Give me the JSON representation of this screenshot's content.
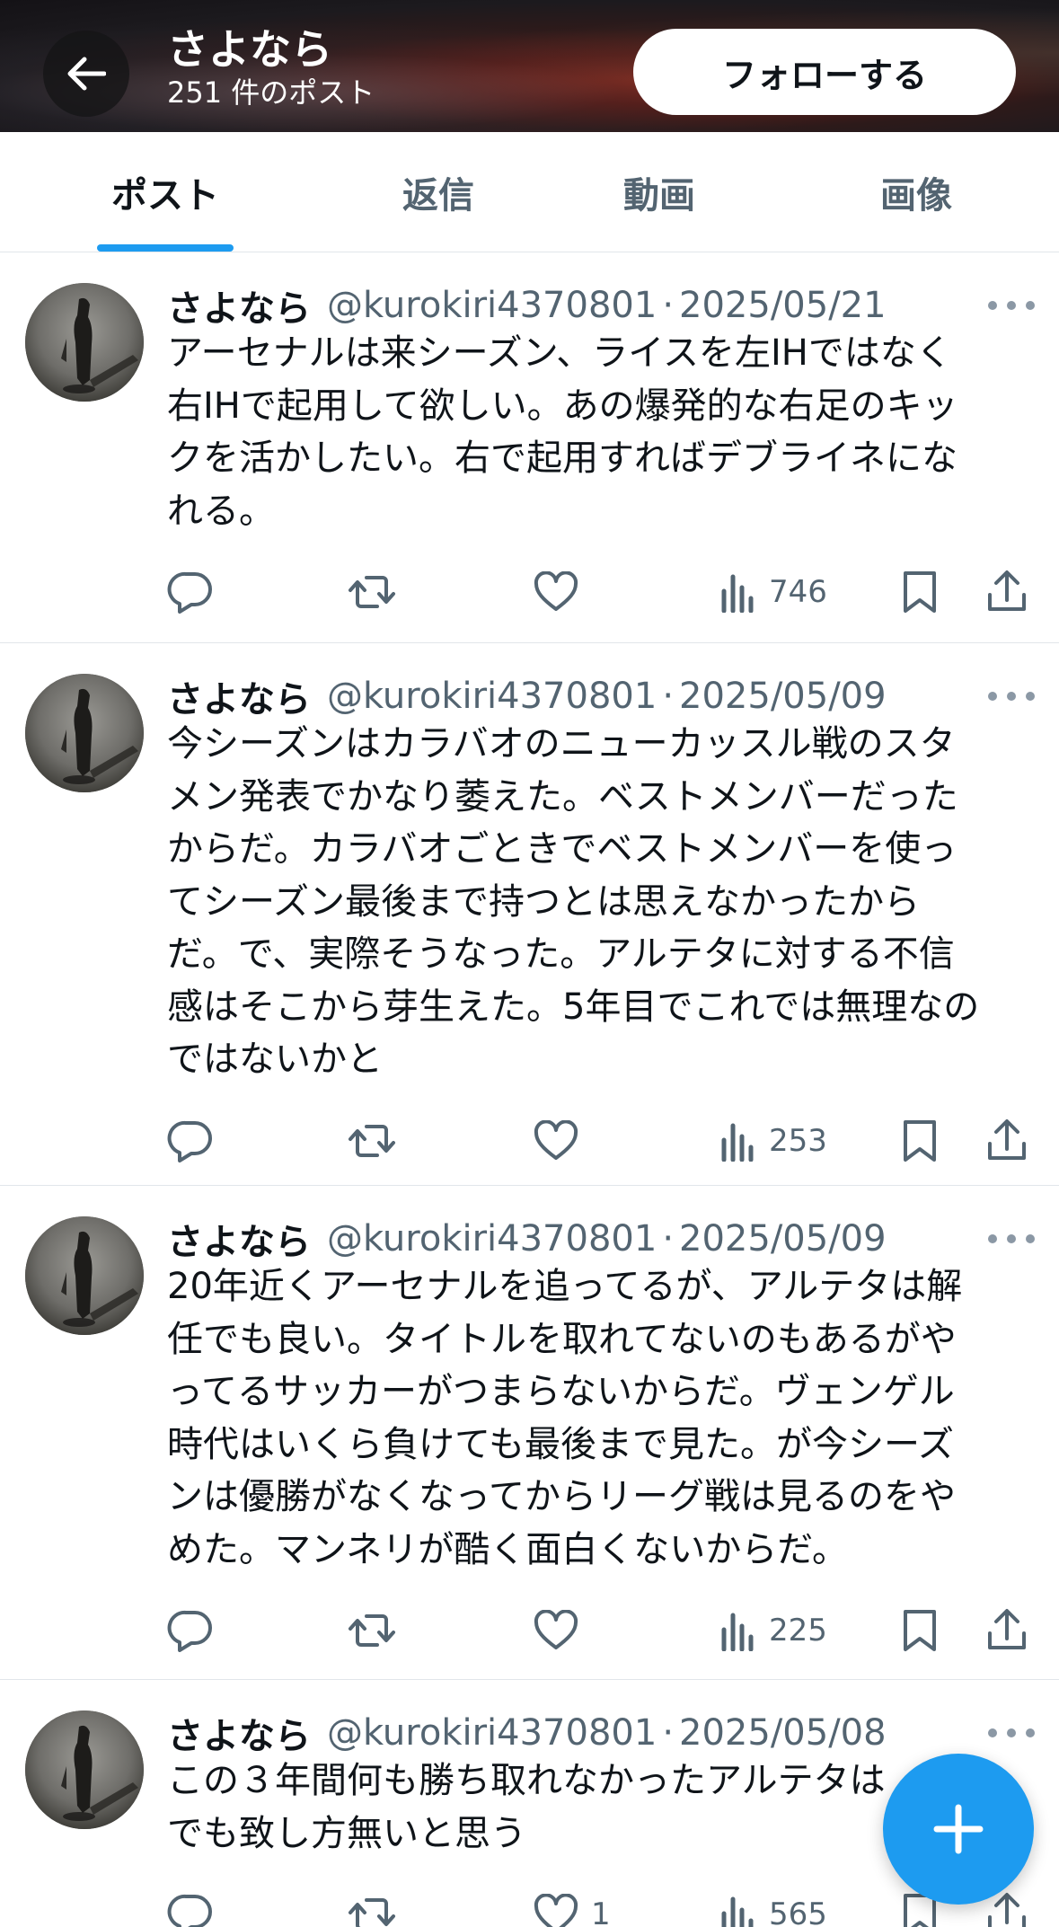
{
  "header": {
    "name": "さよなら",
    "post_count": "251 件のポスト",
    "follow_label": "フォローする"
  },
  "tabs": [
    {
      "label": "ポスト",
      "active": true
    },
    {
      "label": "返信",
      "active": false
    },
    {
      "label": "動画",
      "active": false
    },
    {
      "label": "画像",
      "active": false
    }
  ],
  "colors": {
    "accent": "#1d9bf0",
    "secondary_text": "#536471"
  },
  "icons": [
    "back-arrow-icon",
    "more-icon",
    "reply-icon",
    "repost-icon",
    "like-icon",
    "views-icon",
    "bookmark-icon",
    "share-icon",
    "plus-icon"
  ],
  "posts": [
    {
      "name": "さよなら",
      "handle": "@kurokiri4370801",
      "sep": "·",
      "date": "2025/05/21",
      "lines": [
        "アーセナルは来シーズン、ライスを左IHではなく",
        "右IHで起用して欲しい。あの爆発的な右足のキッ",
        "クを活かしたい。右で起用すればデブライネにな",
        "れる。"
      ],
      "likes": "",
      "views": "746"
    },
    {
      "name": "さよなら",
      "handle": "@kurokiri4370801",
      "sep": "·",
      "date": "2025/05/09",
      "lines": [
        "今シーズンはカラバオのニューカッスル戦のスタ",
        "メン発表でかなり萎えた。ベストメンバーだった",
        "からだ。カラバオごときでベストメンバーを使っ",
        "てシーズン最後まで持つとは思えなかったから",
        "だ。で、実際そうなった。アルテタに対する不信",
        "感はそこから芽生えた。5年目でこれでは無理なの",
        "ではないかと"
      ],
      "likes": "",
      "views": "253"
    },
    {
      "name": "さよなら",
      "handle": "@kurokiri4370801",
      "sep": "·",
      "date": "2025/05/09",
      "lines": [
        "20年近くアーセナルを追ってるが、アルテタは解",
        "任でも良い。タイトルを取れてないのもあるがや",
        "ってるサッカーがつまらないからだ。ヴェンゲル",
        "時代はいくら負けても最後まで見た。が今シーズ",
        "ンは優勝がなくなってからリーグ戦は見るのをや",
        "めた。マンネリが酷く面白くないからだ。"
      ],
      "likes": "",
      "views": "225"
    },
    {
      "name": "さよなら",
      "handle": "@kurokiri4370801",
      "sep": "·",
      "date": "2025/05/08",
      "lines": [
        "この３年間何も勝ち取れなかったアルテタは",
        "でも致し方無いと思う"
      ],
      "likes": "1",
      "views": "565"
    }
  ]
}
